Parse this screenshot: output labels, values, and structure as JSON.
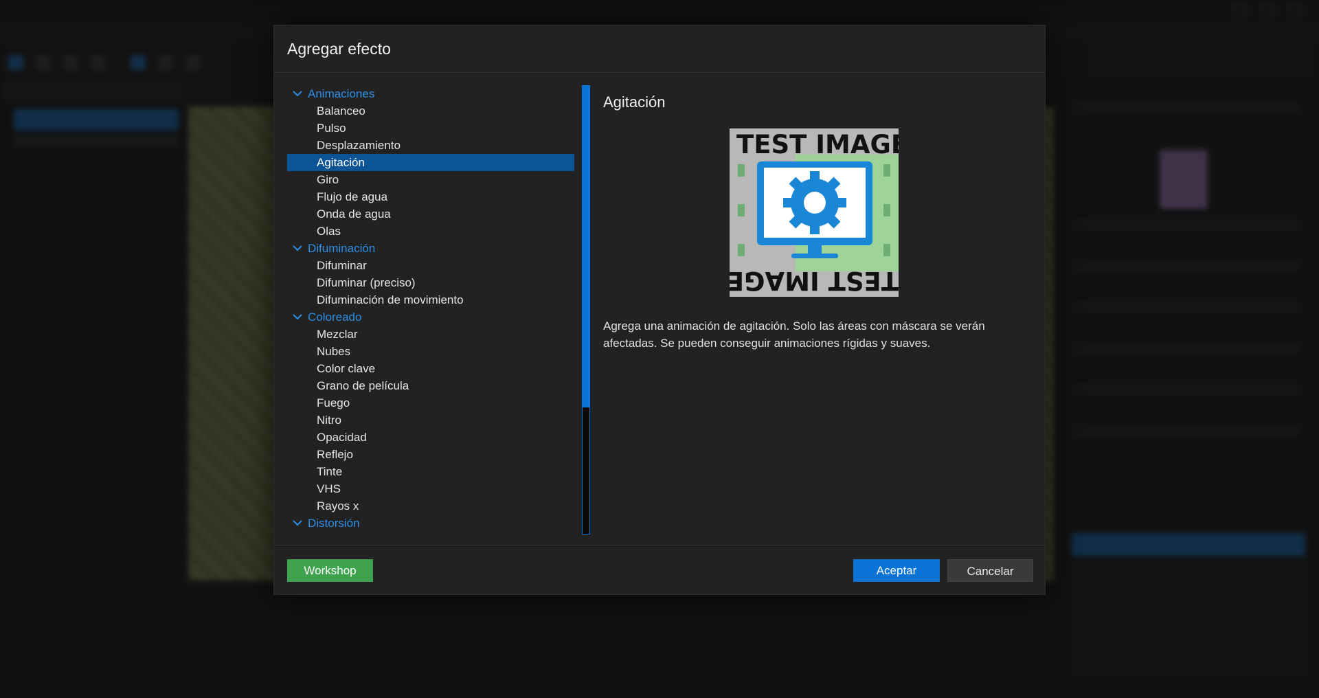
{
  "dialog": {
    "title": "Agregar efecto",
    "categories": [
      {
        "label": "Animaciones",
        "items": [
          "Balanceo",
          "Pulso",
          "Desplazamiento",
          "Agitación",
          "Giro",
          "Flujo de agua",
          "Onda de agua",
          "Olas"
        ]
      },
      {
        "label": "Difuminación",
        "items": [
          "Difuminar",
          "Difuminar (preciso)",
          "Difuminación de movimiento"
        ]
      },
      {
        "label": "Coloreado",
        "items": [
          "Mezclar",
          "Nubes",
          "Color clave",
          "Grano de película",
          "Fuego",
          "Nitro",
          "Opacidad",
          "Reflejo",
          "Tinte",
          "VHS",
          "Rayos x"
        ]
      },
      {
        "label": "Distorsión",
        "items": []
      }
    ],
    "selected_item": "Agitación",
    "detail": {
      "title": "Agitación",
      "preview_text_top": "TEST IMAGE",
      "preview_text_bottom": "TEST IMAGE",
      "description": "Agrega una animación de agitación. Solo las áreas con máscara se verán afectadas. Se pueden conseguir animaciones rígidas y suaves."
    },
    "buttons": {
      "workshop": "Workshop",
      "accept": "Aceptar",
      "cancel": "Cancelar"
    }
  },
  "colors": {
    "accent": "#0a74d6",
    "category_text": "#2e8ee6",
    "selection": "#0d5496",
    "workshop": "#3fa24f",
    "dialog_bg": "#222222"
  },
  "icons": [
    "chevron-down-icon",
    "gear-icon",
    "monitor-icon"
  ]
}
